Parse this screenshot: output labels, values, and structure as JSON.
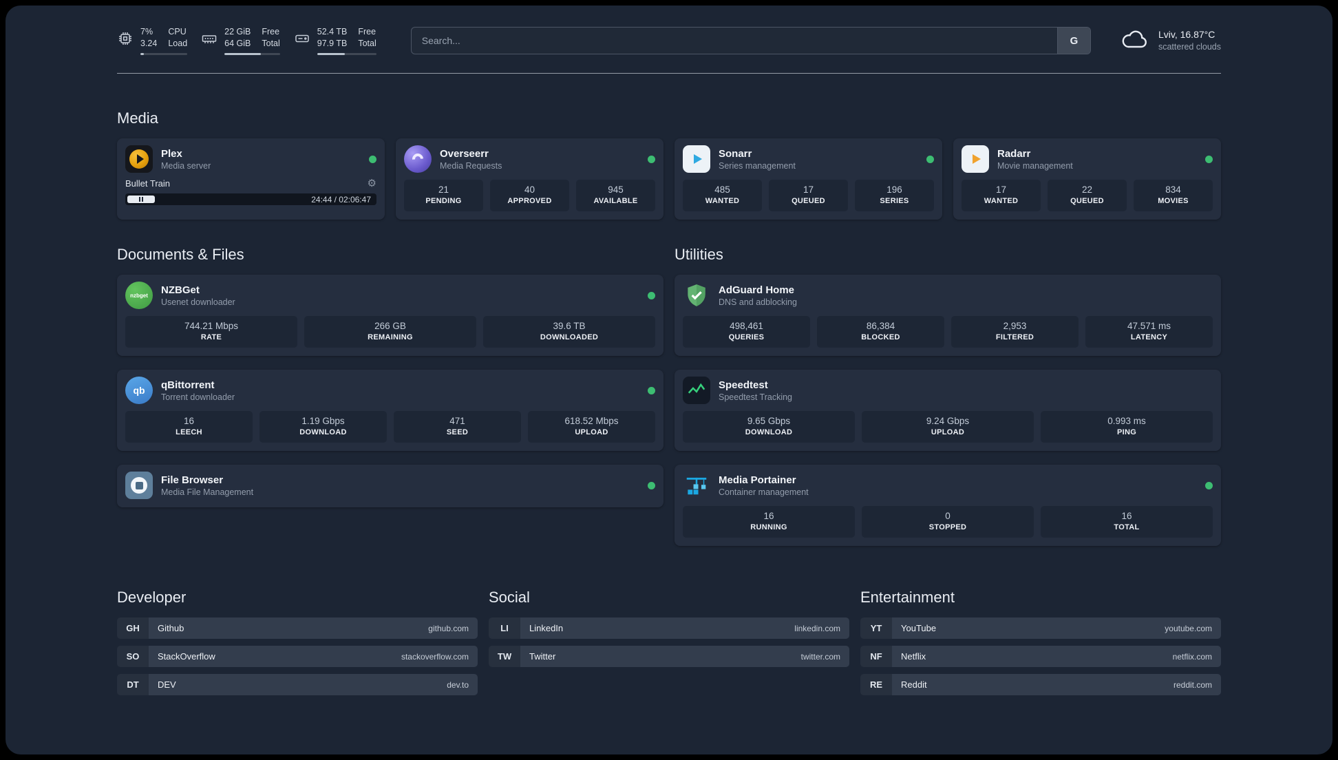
{
  "topbar": {
    "cpu": {
      "v1": "7%",
      "v2": "3.24",
      "l1": "CPU",
      "l2": "Load",
      "fill_style": "width:7%"
    },
    "memory": {
      "v1": "22 GiB",
      "v2": "64 GiB",
      "l1": "Free",
      "l2": "Total",
      "fill_style": "width:66%"
    },
    "disk": {
      "v1": "52.4 TB",
      "v2": "97.9 TB",
      "l1": "Free",
      "l2": "Total",
      "fill_style": "width:47%"
    },
    "search": {
      "placeholder": "Search...",
      "button_label": "G"
    },
    "weather": {
      "location": "Lviv, 16.87°C",
      "condition": "scattered clouds"
    }
  },
  "sections": {
    "media": {
      "title": "Media",
      "plex": {
        "name": "Plex",
        "desc": "Media server",
        "now_playing": {
          "title": "Bullet Train",
          "time": "24:44 / 02:06:47",
          "progress_style": "width:11%"
        }
      },
      "overseerr": {
        "name": "Overseerr",
        "desc": "Media Requests",
        "stats": [
          {
            "value": "21",
            "label": "PENDING"
          },
          {
            "value": "40",
            "label": "APPROVED"
          },
          {
            "value": "945",
            "label": "AVAILABLE"
          }
        ]
      },
      "sonarr": {
        "name": "Sonarr",
        "desc": "Series management",
        "stats": [
          {
            "value": "485",
            "label": "WANTED"
          },
          {
            "value": "17",
            "label": "QUEUED"
          },
          {
            "value": "196",
            "label": "SERIES"
          }
        ]
      },
      "radarr": {
        "name": "Radarr",
        "desc": "Movie management",
        "stats": [
          {
            "value": "17",
            "label": "WANTED"
          },
          {
            "value": "22",
            "label": "QUEUED"
          },
          {
            "value": "834",
            "label": "MOVIES"
          }
        ]
      }
    },
    "documents": {
      "title": "Documents & Files",
      "nzbget": {
        "name": "NZBGet",
        "desc": "Usenet downloader",
        "stats": [
          {
            "value": "744.21 Mbps",
            "label": "RATE"
          },
          {
            "value": "266 GB",
            "label": "REMAINING"
          },
          {
            "value": "39.6 TB",
            "label": "DOWNLOADED"
          }
        ]
      },
      "qbittorrent": {
        "name": "qBittorrent",
        "desc": "Torrent downloader",
        "stats": [
          {
            "value": "16",
            "label": "LEECH"
          },
          {
            "value": "1.19 Gbps",
            "label": "DOWNLOAD"
          },
          {
            "value": "471",
            "label": "SEED"
          },
          {
            "value": "618.52 Mbps",
            "label": "UPLOAD"
          }
        ]
      },
      "filebrowser": {
        "name": "File Browser",
        "desc": "Media File Management"
      }
    },
    "utilities": {
      "title": "Utilities",
      "adguard": {
        "name": "AdGuard Home",
        "desc": "DNS and adblocking",
        "stats": [
          {
            "value": "498,461",
            "label": "QUERIES"
          },
          {
            "value": "86,384",
            "label": "BLOCKED"
          },
          {
            "value": "2,953",
            "label": "FILTERED"
          },
          {
            "value": "47.571 ms",
            "label": "LATENCY"
          }
        ]
      },
      "speedtest": {
        "name": "Speedtest",
        "desc": "Speedtest Tracking",
        "stats": [
          {
            "value": "9.65 Gbps",
            "label": "DOWNLOAD"
          },
          {
            "value": "9.24 Gbps",
            "label": "UPLOAD"
          },
          {
            "value": "0.993 ms",
            "label": "PING"
          }
        ]
      },
      "portainer": {
        "name": "Media Portainer",
        "desc": "Container management",
        "stats": [
          {
            "value": "16",
            "label": "RUNNING"
          },
          {
            "value": "0",
            "label": "STOPPED"
          },
          {
            "value": "16",
            "label": "TOTAL"
          }
        ]
      }
    },
    "bookmarks": [
      {
        "title": "Developer",
        "items": [
          {
            "abbr": "GH",
            "name": "Github",
            "url": "github.com"
          },
          {
            "abbr": "SO",
            "name": "StackOverflow",
            "url": "stackoverflow.com"
          },
          {
            "abbr": "DT",
            "name": "DEV",
            "url": "dev.to"
          }
        ]
      },
      {
        "title": "Social",
        "items": [
          {
            "abbr": "LI",
            "name": "LinkedIn",
            "url": "linkedin.com"
          },
          {
            "abbr": "TW",
            "name": "Twitter",
            "url": "twitter.com"
          }
        ]
      },
      {
        "title": "Entertainment",
        "items": [
          {
            "abbr": "YT",
            "name": "YouTube",
            "url": "youtube.com"
          },
          {
            "abbr": "NF",
            "name": "Netflix",
            "url": "netflix.com"
          },
          {
            "abbr": "RE",
            "name": "Reddit",
            "url": "reddit.com"
          }
        ]
      }
    ]
  },
  "icons": {
    "nzbget_text": "nzbget",
    "qbittorrent_text": "qb"
  }
}
